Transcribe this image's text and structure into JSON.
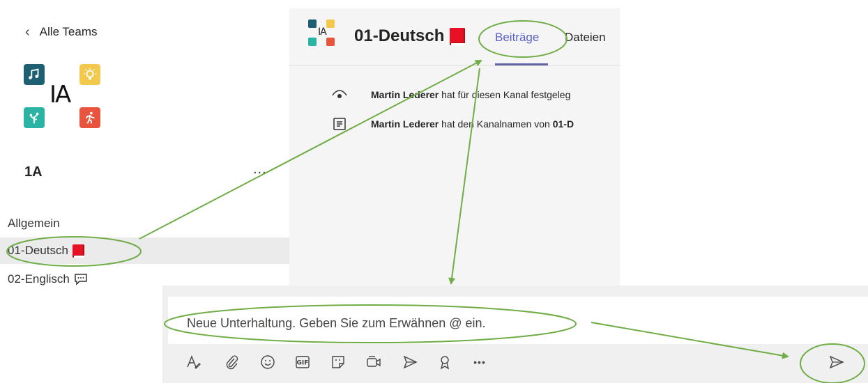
{
  "nav": {
    "back_label": "Alle Teams"
  },
  "team": {
    "logo_text": "IA",
    "name": "1A",
    "more_label": "...",
    "colors": {
      "music": "#1e5f74",
      "idea": "#f2c94c",
      "nature": "#2bb3a3",
      "sport": "#e8553e"
    }
  },
  "channels": [
    {
      "label": "Allgemein",
      "icon": ""
    },
    {
      "label": "01-Deutsch",
      "icon": "red-book-icon"
    },
    {
      "label": "02-Englisch",
      "icon": "speech-bubble-icon"
    }
  ],
  "channel_header": {
    "title": "01-Deutsch",
    "tabs": [
      {
        "label": "Beiträge",
        "active": true
      },
      {
        "label": "Dateien",
        "active": false
      }
    ],
    "accent_color": "#6264a7"
  },
  "activity": [
    {
      "icon": "eye-icon",
      "author": "Martin Lederer",
      "text": "hat für diesen Kanal festgeleg"
    },
    {
      "icon": "rename-icon",
      "author": "Martin Lederer",
      "text_before": "hat den Kanalnamen von ",
      "text_bold": "01-D"
    }
  ],
  "compose": {
    "placeholder": "Neue Unterhaltung. Geben Sie zum Erwähnen @ ein.",
    "toolbar": [
      "format-icon",
      "attach-icon",
      "emoji-icon",
      "gif-icon",
      "sticker-icon",
      "meet-now-icon",
      "stream-icon",
      "praise-icon",
      "more-options-icon"
    ],
    "gif_label": "GIF",
    "more_label": "•••"
  },
  "annotation_color": "#70ad47"
}
